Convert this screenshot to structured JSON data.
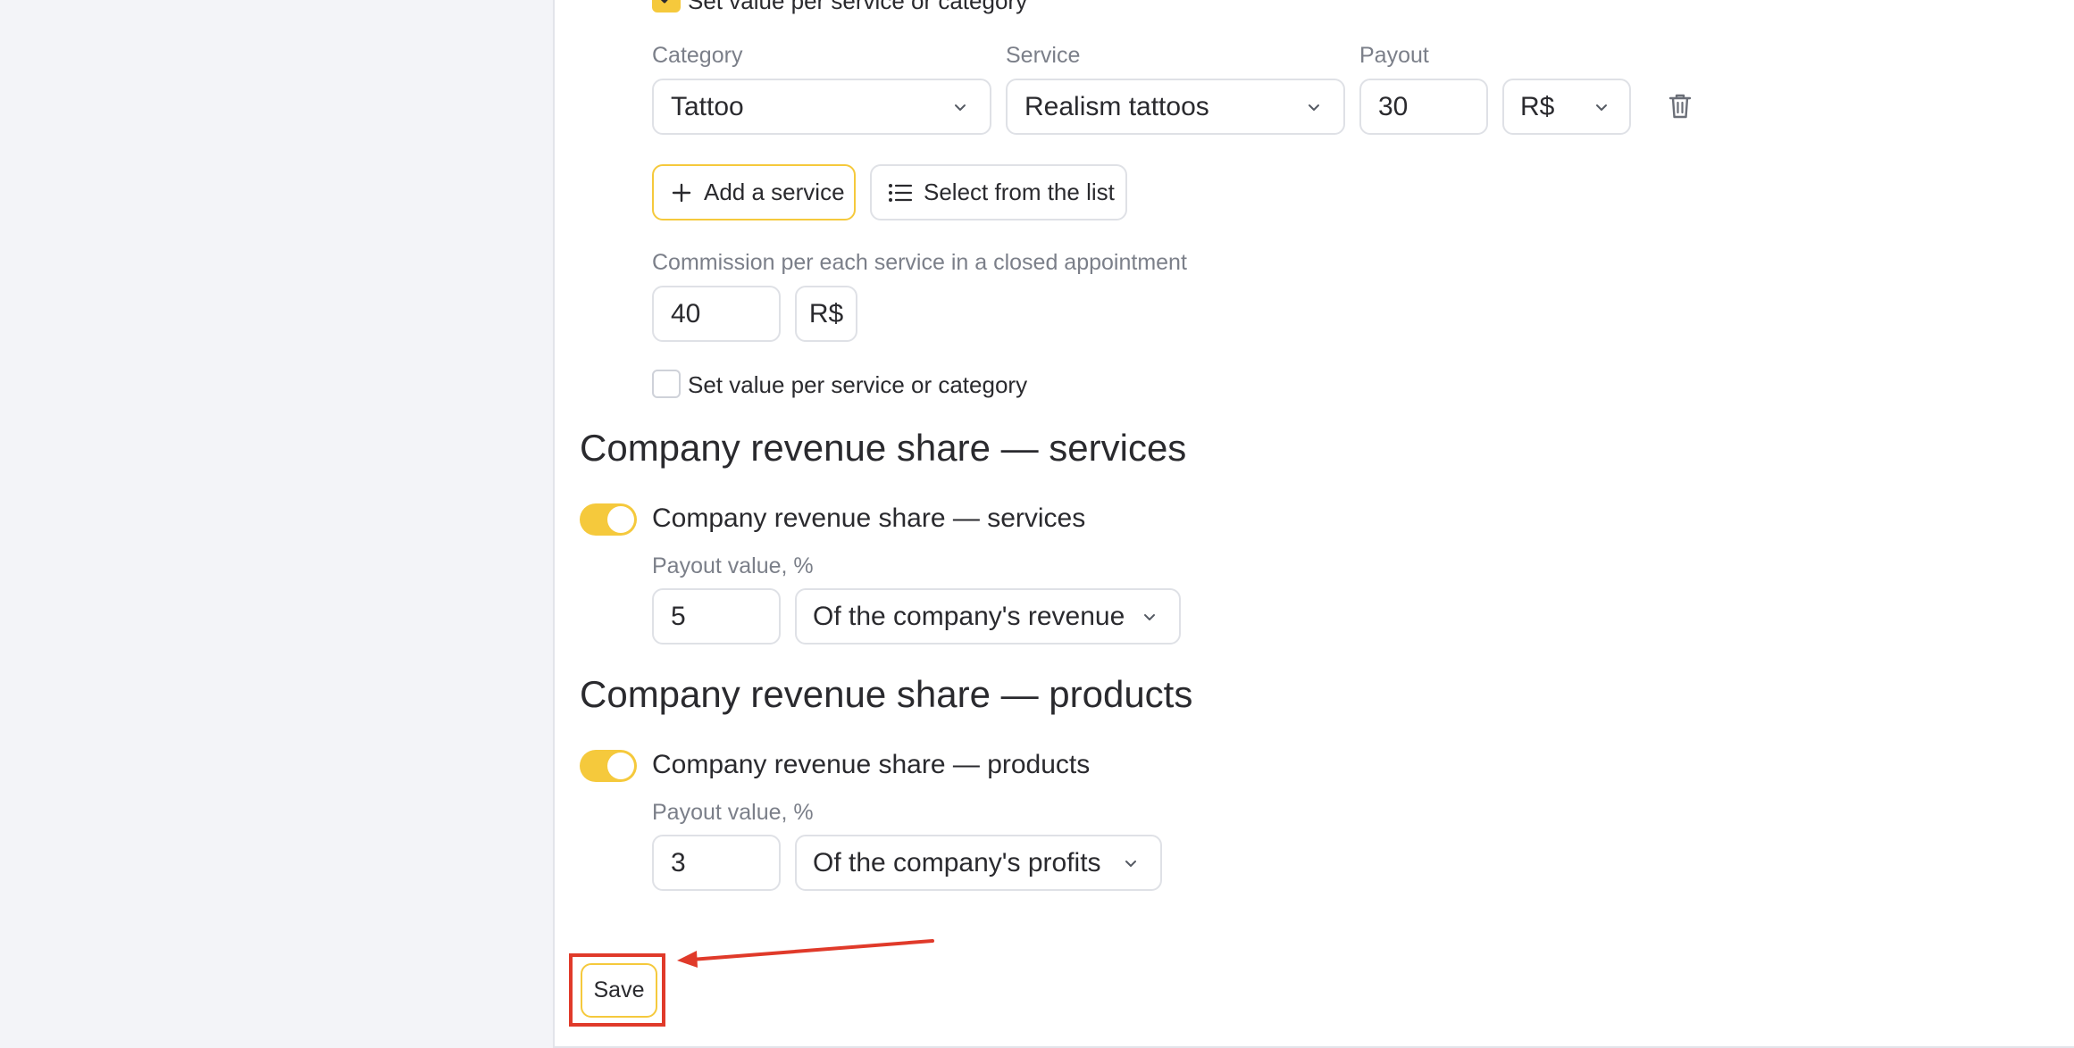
{
  "top": {
    "checkbox_label": "Set value per service or category",
    "checkbox_checked": true
  },
  "row": {
    "category_label": "Category",
    "service_label": "Service",
    "payout_label": "Payout",
    "category_value": "Tattoo",
    "service_value": "Realism tattoos",
    "payout_value": "30",
    "currency_value": "R$",
    "delete_icon": "trash-icon"
  },
  "actions": {
    "add_service": "Add a service",
    "select_list": "Select from the list"
  },
  "commission": {
    "label": "Commission per each service in a closed appointment",
    "value": "40",
    "currency": "R$",
    "checkbox_label": "Set value per service or category",
    "checkbox_checked": false
  },
  "services_share": {
    "heading": "Company revenue share — services",
    "toggle_label": "Company revenue share — services",
    "toggle_on": true,
    "payout_label": "Payout value, %",
    "value": "5",
    "basis": "Of the company's revenue"
  },
  "products_share": {
    "heading": "Company revenue share — products",
    "toggle_label": "Company revenue share — products",
    "toggle_on": true,
    "payout_label": "Payout value, %",
    "value": "3",
    "basis": "Of the company's profits"
  },
  "footer": {
    "save_label": "Save"
  },
  "colors": {
    "accent": "#f5c93c",
    "annotation": "#e03a2a",
    "sidebar_bg": "#f3f4f8",
    "border": "#dfe1e6"
  }
}
